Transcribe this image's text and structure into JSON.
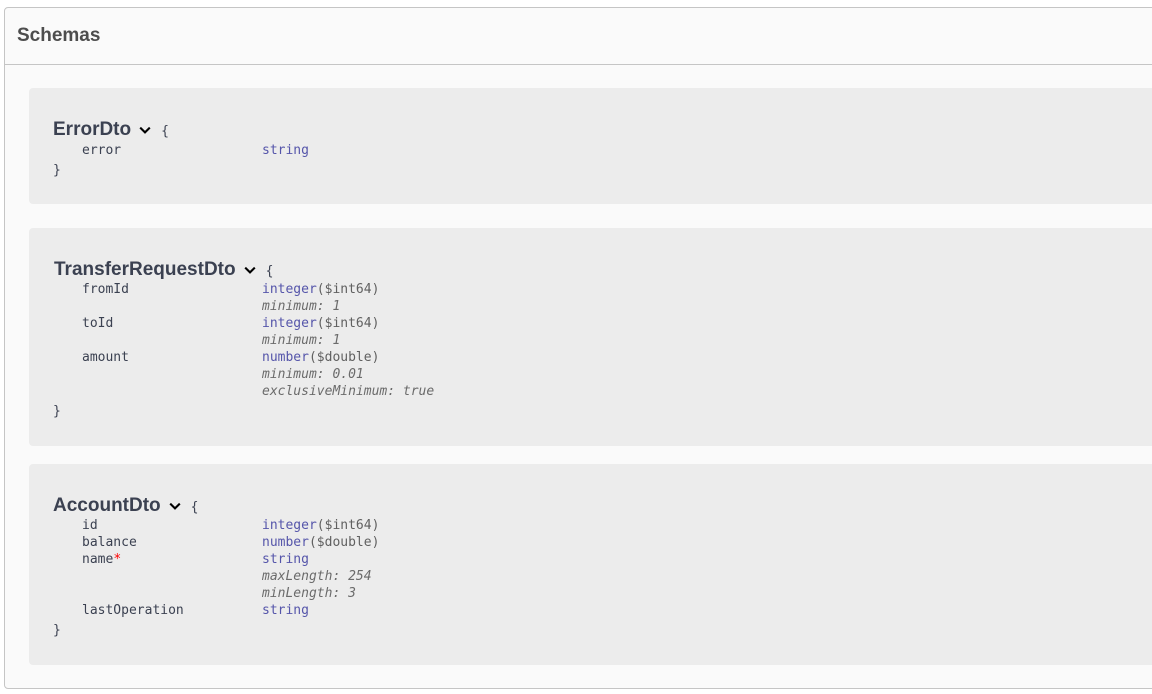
{
  "section": {
    "title": "Schemas"
  },
  "brace_open": "{",
  "brace_close": "}",
  "models": [
    {
      "name": "ErrorDto",
      "properties": [
        {
          "name": "error",
          "type": "string",
          "format": "",
          "required": false,
          "constraints": []
        }
      ]
    },
    {
      "name": "TransferRequestDto",
      "properties": [
        {
          "name": "fromId",
          "type": "integer",
          "format": "($int64)",
          "required": false,
          "constraints": [
            "minimum: 1"
          ]
        },
        {
          "name": "toId",
          "type": "integer",
          "format": "($int64)",
          "required": false,
          "constraints": [
            "minimum: 1"
          ]
        },
        {
          "name": "amount",
          "type": "number",
          "format": "($double)",
          "required": false,
          "constraints": [
            "minimum: 0.01",
            "exclusiveMinimum: true"
          ]
        }
      ]
    },
    {
      "name": "AccountDto",
      "properties": [
        {
          "name": "id",
          "type": "integer",
          "format": "($int64)",
          "required": false,
          "constraints": []
        },
        {
          "name": "balance",
          "type": "number",
          "format": "($double)",
          "required": false,
          "constraints": []
        },
        {
          "name": "name",
          "type": "string",
          "format": "",
          "required": true,
          "required_mark": "*",
          "constraints": [
            "maxLength: 254",
            "minLength: 3"
          ]
        },
        {
          "name": "lastOperation",
          "type": "string",
          "format": "",
          "required": false,
          "constraints": []
        }
      ]
    }
  ],
  "colors": {
    "type": "#5555aa",
    "required_star": "#ff0000",
    "card_bg": "#ececec",
    "text": "#3b4151"
  },
  "icons": {
    "expand": "chevron-down-icon"
  }
}
